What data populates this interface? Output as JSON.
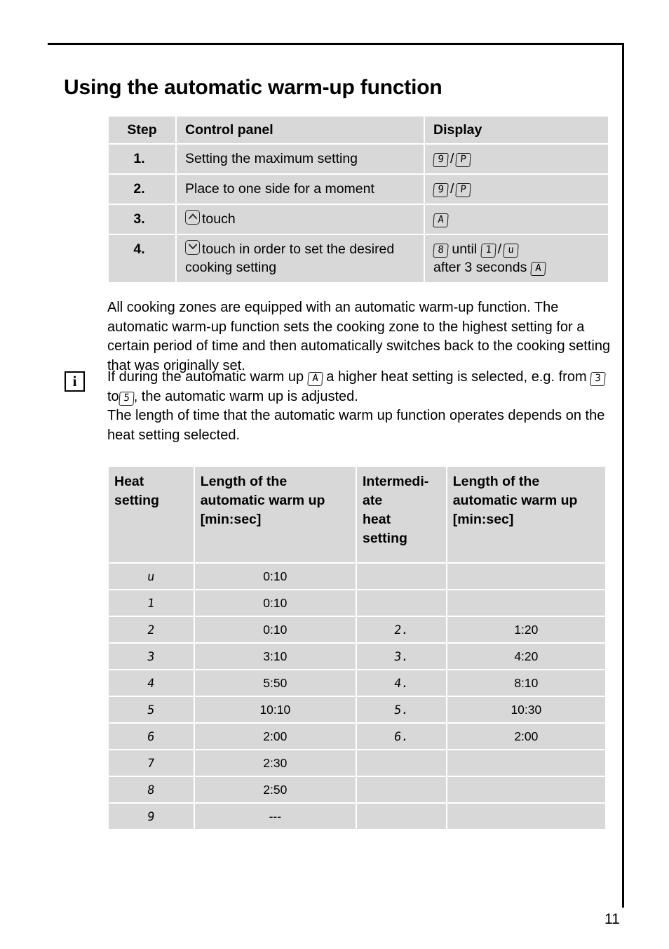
{
  "page": {
    "title": "Using the automatic warm-up function",
    "number": "11"
  },
  "steps_table": {
    "headers": {
      "step": "Step",
      "control_panel": "Control panel",
      "display": "Display"
    },
    "rows": [
      {
        "step": "1.",
        "control_text": "Setting the maximum setting",
        "control_icon": "",
        "display_parts": [
          {
            "type": "seg",
            "text": "9"
          },
          {
            "type": "text",
            "text": "/"
          },
          {
            "type": "seg",
            "text": "P"
          }
        ]
      },
      {
        "step": "2.",
        "control_text": "Place to one side for a moment",
        "control_icon": "",
        "display_parts": [
          {
            "type": "seg",
            "text": "9"
          },
          {
            "type": "text",
            "text": "/"
          },
          {
            "type": "seg",
            "text": "P"
          }
        ]
      },
      {
        "step": "3.",
        "control_text": "touch",
        "control_icon": "chevron-up-icon",
        "display_parts": [
          {
            "type": "seg",
            "text": "A"
          }
        ]
      },
      {
        "step": "4.",
        "control_text": "touch in order to set the desired cooking setting",
        "control_icon": "chevron-down-icon",
        "display_parts": [
          {
            "type": "seg",
            "text": "8"
          },
          {
            "type": "text",
            "text": "until"
          },
          {
            "type": "seg",
            "text": "1"
          },
          {
            "type": "text",
            "text": "/"
          },
          {
            "type": "seg",
            "text": "u"
          },
          {
            "type": "break",
            "text": ""
          },
          {
            "type": "text",
            "text": "after 3 seconds"
          },
          {
            "type": "seg",
            "text": "A"
          }
        ]
      }
    ]
  },
  "paragraphs": {
    "intro": "All cooking zones are equipped with an automatic warm-up function. The automatic warm-up function sets the cooking zone to the highest setting for a certain period of time and then automatically switches back to the cooking setting that was originally set.",
    "note_line1_a": "If during the automatic warm up",
    "note_seg1": "A",
    "note_line1_b": "a higher heat setting is selected,",
    "note_line2_a": "e.g. from",
    "note_seg2": "3",
    "note_line2_b": "to",
    "note_seg3": "5",
    "note_line2_c": ", the automatic warm up is adjusted.",
    "note_line3": "The length of time that the automatic warm up function operates depends on the heat setting selected.",
    "info_icon_label": "i"
  },
  "durations_table": {
    "headers": {
      "heat_setting": "Heat\nsetting",
      "length_1": "Length of the\nautomatic warm up\n[min:sec]",
      "intermediate": "Intermedi-\nate\nheat\nsetting",
      "length_2": "Length of the\nautomatic warm up\n[min:sec]"
    },
    "rows": [
      {
        "heat": "u",
        "len1": "0:10",
        "inter": "",
        "len2": ""
      },
      {
        "heat": "1",
        "len1": "0:10",
        "inter": "",
        "len2": ""
      },
      {
        "heat": "2",
        "len1": "0:10",
        "inter": "2.",
        "len2": "1:20"
      },
      {
        "heat": "3",
        "len1": "3:10",
        "inter": "3.",
        "len2": "4:20"
      },
      {
        "heat": "4",
        "len1": "5:50",
        "inter": "4.",
        "len2": "8:10"
      },
      {
        "heat": "5",
        "len1": "10:10",
        "inter": "5.",
        "len2": "10:30"
      },
      {
        "heat": "6",
        "len1": "2:00",
        "inter": "6.",
        "len2": "2:00"
      },
      {
        "heat": "7",
        "len1": "2:30",
        "inter": "",
        "len2": ""
      },
      {
        "heat": "8",
        "len1": "2:50",
        "inter": "",
        "len2": ""
      },
      {
        "heat": "9",
        "len1": "---",
        "inter": "",
        "len2": ""
      }
    ]
  },
  "colors": {
    "cell_background": "#d8d8d8",
    "text": "#000000",
    "page_background": "#ffffff"
  }
}
